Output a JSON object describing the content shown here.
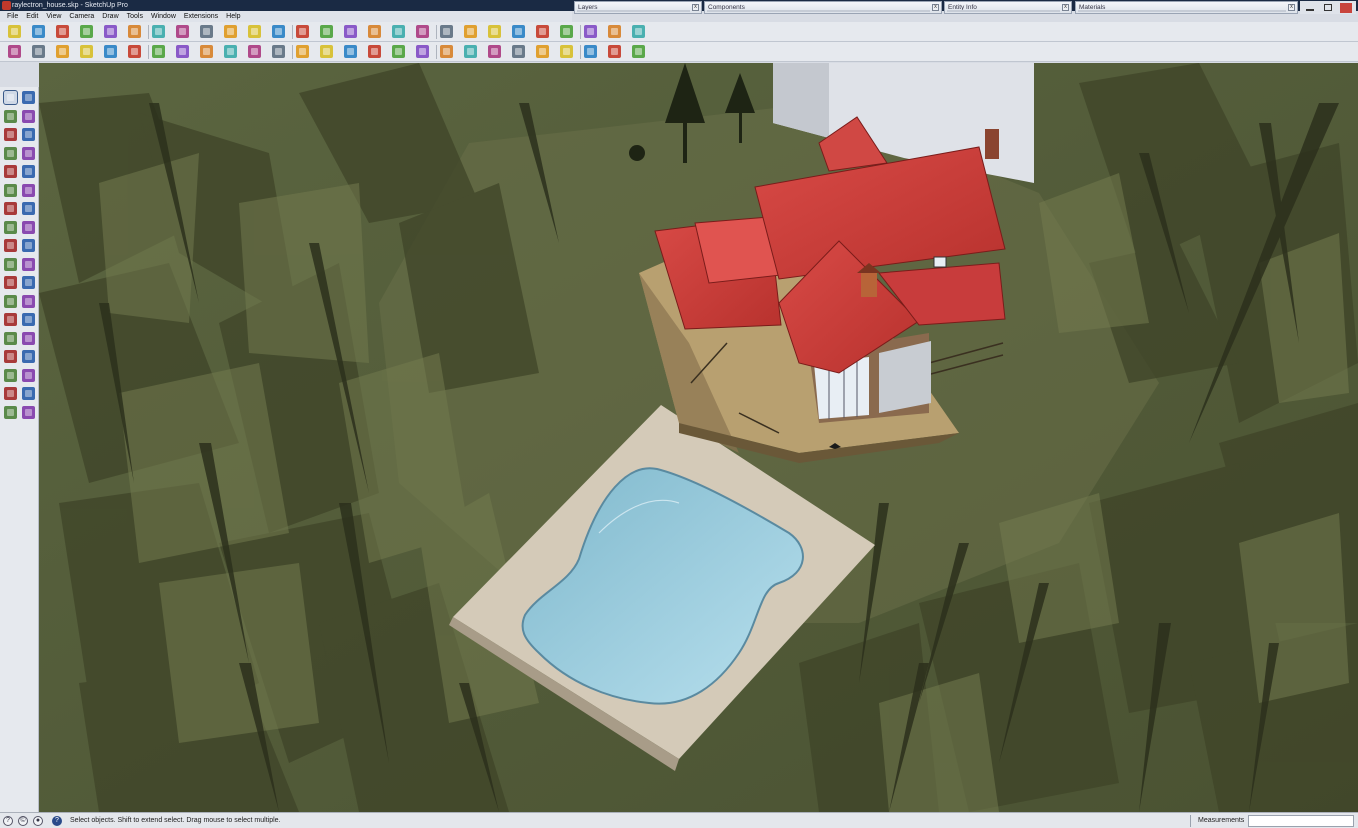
{
  "window": {
    "title": "raylectron_house.skp - SketchUp Pro"
  },
  "menu": [
    "File",
    "Edit",
    "View",
    "Camera",
    "Draw",
    "Tools",
    "Window",
    "Extensions",
    "Help"
  ],
  "panels": [
    {
      "title": "Layers",
      "close": "x"
    },
    {
      "title": "Components",
      "close": "x"
    },
    {
      "title": "Entity Info",
      "close": "x"
    },
    {
      "title": "Materials",
      "close": "x"
    }
  ],
  "toolbar_icons": [
    "new-file-icon",
    "open-file-icon",
    "save-icon",
    "print-icon",
    "select-icon",
    "eraser-icon",
    "paint-bucket-icon",
    "line-icon",
    "arc-icon",
    "rectangle-icon",
    "circle-icon",
    "polygon-icon",
    "move-icon",
    "rotate-icon",
    "scale-icon",
    "push-pull-icon",
    "follow-me-icon",
    "offset-icon",
    "tape-measure-icon",
    "protractor-icon",
    "dimension-icon",
    "text-icon",
    "axes-icon",
    "section-plane-icon",
    "orbit-icon",
    "pan-icon",
    "zoom-icon",
    "zoom-extents-icon",
    "previous-view-icon",
    "next-view-icon",
    "iso-view-icon",
    "top-view-icon",
    "front-view-icon",
    "right-view-icon",
    "back-view-icon",
    "left-view-icon",
    "xray-icon",
    "wireframe-icon",
    "hidden-line-icon",
    "shaded-icon",
    "shaded-textures-icon",
    "monochrome-icon",
    "sandbox-icon",
    "smoove-icon",
    "stamp-icon",
    "drape-icon",
    "add-detail-icon",
    "flip-edge-icon",
    "warehouse-icon",
    "share-model-icon",
    "extension-warehouse-icon",
    "layer-manager-icon",
    "shadows-icon",
    "fog-icon"
  ],
  "left_tools": [
    "select-tool-icon",
    "make-component-icon",
    "paint-bucket-tool-icon",
    "eraser-tool-icon",
    "pencil-tool-icon",
    "freehand-tool-icon",
    "rectangle-tool-icon",
    "rotated-rectangle-icon",
    "circle-tool-icon",
    "polygon-tool-icon",
    "arc-tool-icon",
    "pie-tool-icon",
    "two-point-arc-icon",
    "three-point-arc-icon",
    "move-tool-icon",
    "push-pull-tool-icon",
    "rotate-tool-icon",
    "follow-me-tool-icon",
    "scale-tool-icon",
    "offset-tool-icon",
    "tape-measure-tool-icon",
    "dimension-tool-icon",
    "protractor-tool-icon",
    "text-tool-icon",
    "axes-tool-icon",
    "3d-text-icon",
    "orbit-tool-icon",
    "pan-tool-icon",
    "zoom-tool-icon",
    "zoom-window-icon",
    "zoom-extents-tool-icon",
    "previous-tool-icon",
    "position-camera-icon",
    "look-around-icon",
    "walk-icon",
    "section-tool-icon"
  ],
  "status": {
    "hint": "Select objects. Shift to extend select. Drag mouse to select multiple.",
    "measurements_label": "Measurements",
    "measurements_value": ""
  },
  "colors": {
    "roof": "#c83c3c",
    "terrain": "#56603a",
    "pool_water": "#a8d4e4",
    "pool_deck": "#d4cab8",
    "deck_wood": "#b8a070",
    "sky_building": "#d4d8de"
  }
}
